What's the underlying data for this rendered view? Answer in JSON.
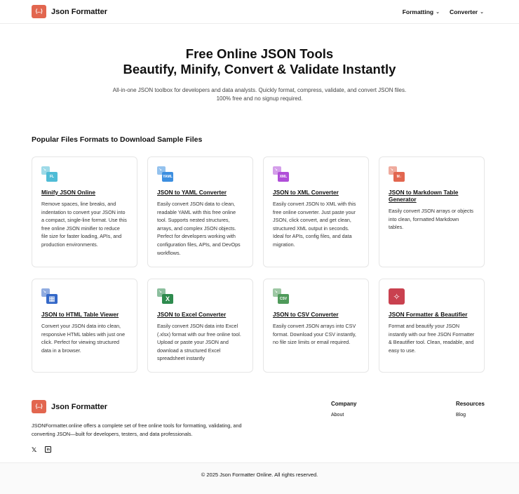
{
  "nav": {
    "brand_logo": "{...}",
    "brand_name": "Json Formatter",
    "menu": [
      {
        "label": "Formatting"
      },
      {
        "label": "Converter"
      }
    ]
  },
  "hero": {
    "title_line1": "Free Online JSON Tools",
    "title_line2": "Beautify, Minify, Convert & Validate Instantly",
    "subtitle_line1": "All-in-one JSON toolbox for developers and data analysts. Quickly format, compress, validate, and convert JSON files.",
    "subtitle_line2": "100% free and no signup required."
  },
  "section_title": "Popular Files Formats to Download Sample Files",
  "cards": [
    {
      "title": "Minify JSON Online",
      "icon_text": "FL",
      "color": "#4fbcd6",
      "desc": "Remove spaces, line breaks, and indentation to convert your JSON into a compact, single-line format. Use this free online JSON minifier to reduce file size for faster loading, APIs, and production environments."
    },
    {
      "title": "JSON to YAML Converter",
      "icon_text": "YAML",
      "color": "#3d8fe0",
      "desc": "Easily convert JSON data to clean, readable YAML with this free online tool. Supports nested structures, arrays, and complex JSON objects. Perfect for developers working with configuration files, APIs, and DevOps workflows."
    },
    {
      "title": "JSON to XML Converter",
      "icon_text": "XML",
      "color": "#b04ed8",
      "desc": "Easily convert JSON to XML with this free online converter. Just paste your JSON, click convert, and get clean, structured XML output in seconds. Ideal for APIs, config files, and data migration."
    },
    {
      "title": "JSON to Markdown Table Generator",
      "icon_text": "M↓",
      "color": "#e2664f",
      "desc": "Easily convert JSON arrays or objects into clean, formatted Markdown tables."
    },
    {
      "title": "JSON to HTML Table Viewer",
      "icon_text": "▦",
      "color": "#3468c8",
      "desc": "Convert your JSON data into clean, responsive HTML tables with just one click. Perfect for viewing structured data in a browser."
    },
    {
      "title": "JSON to Excel Converter",
      "icon_text": "X",
      "color": "#2e8b4e",
      "desc": "Easily convert JSON data into Excel (.xlsx) format with our free online tool. Upload or paste your JSON and download a structured Excel spreadsheet instantly"
    },
    {
      "title": "JSON to CSV Converter",
      "icon_text": "CSV",
      "color": "#4f9a5a",
      "desc": "Easily convert JSON arrays into CSV format. Download your CSV instantly, no file size limits or email required."
    },
    {
      "title": "JSON Formatter & Beautifier",
      "icon_text": "✧",
      "color": "#c9414f",
      "desc": "Format and beautify your JSON instantly with our free JSON Formatter & Beautifier tool. Clean, readable, and easy to use."
    }
  ],
  "footer": {
    "brand_logo": "{...}",
    "brand_name": "Json Formatter",
    "desc": "JSONFormatter.online offers a complete set of free online tools for formatting, validating, and converting JSON—built for developers, testers, and data professionals.",
    "social": {
      "x": "𝕏",
      "linkedin": "in"
    },
    "company": {
      "heading": "Company",
      "link": "About"
    },
    "resources": {
      "heading": "Resources",
      "link": "Blog"
    },
    "copyright": "© 2025 Json Formatter Online. All rights reserved."
  }
}
